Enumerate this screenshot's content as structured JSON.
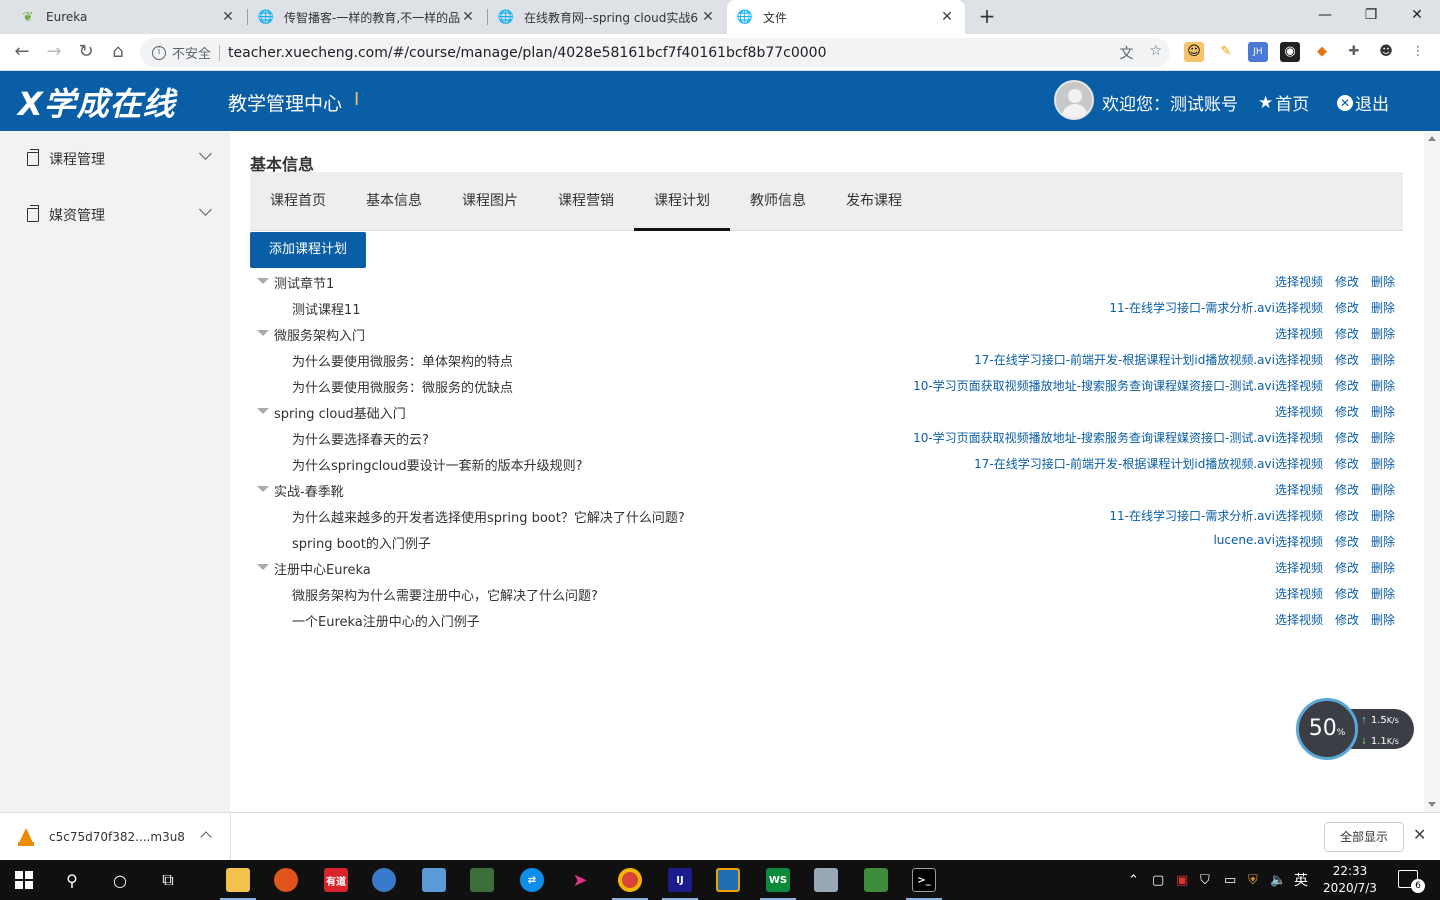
{
  "browser": {
    "tabs": [
      {
        "title": "Eureka",
        "icon": "leaf-icon"
      },
      {
        "title": "传智播客-一样的教育,不一样的品",
        "icon": "globe-icon"
      },
      {
        "title": "在线教育网--spring cloud实战6",
        "icon": "globe-icon"
      },
      {
        "title": "文件",
        "icon": "globe-icon"
      }
    ],
    "insecure_label": "不安全",
    "url": "teacher.xuecheng.com/#/course/manage/plan/4028e58161bcf7f40161bcf8b77c0000"
  },
  "header": {
    "logo": "X学成在线",
    "system_title": "教学管理中心",
    "welcome": "欢迎您：测试账号",
    "home_label": "首页",
    "logout_label": "退出"
  },
  "sidebar": {
    "items": [
      {
        "label": "课程管理"
      },
      {
        "label": "媒资管理"
      }
    ]
  },
  "main": {
    "page_title": "基本信息",
    "tabs": [
      "课程首页",
      "基本信息",
      "课程图片",
      "课程营销",
      "课程计划",
      "教师信息",
      "发布课程"
    ],
    "active_tab": "课程计划",
    "add_button": "添加课程计划",
    "actions": {
      "select_video": "选择视频",
      "edit": "修改",
      "delete": "删除"
    },
    "tree": [
      {
        "level": 1,
        "label": "测试章节1",
        "video": ""
      },
      {
        "level": 2,
        "label": "测试课程11",
        "video": "11-在线学习接口-需求分析.avi"
      },
      {
        "level": 1,
        "label": "微服务架构入门",
        "video": ""
      },
      {
        "level": 2,
        "label": "为什么要使用微服务：单体架构的特点",
        "video": "17-在线学习接口-前端开发-根据课程计划id播放视频.avi"
      },
      {
        "level": 2,
        "label": "为什么要使用微服务：微服务的优缺点",
        "video": "10-学习页面获取视频播放地址-搜索服务查询课程媒资接口-测试.avi"
      },
      {
        "level": 1,
        "label": "spring cloud基础入门",
        "video": ""
      },
      {
        "level": 2,
        "label": "为什么要选择春天的云?",
        "video": "10-学习页面获取视频播放地址-搜索服务查询课程媒资接口-测试.avi"
      },
      {
        "level": 2,
        "label": "为什么springcloud要设计一套新的版本升级规则?",
        "video": "17-在线学习接口-前端开发-根据课程计划id播放视频.avi"
      },
      {
        "level": 1,
        "label": "实战-春季靴",
        "video": ""
      },
      {
        "level": 2,
        "label": "为什么越来越多的开发者选择使用spring boot？它解决了什么问题?",
        "video": "11-在线学习接口-需求分析.avi"
      },
      {
        "level": 2,
        "label": "spring boot的入门例子",
        "video": "lucene.avi"
      },
      {
        "level": 1,
        "label": "注册中心Eureka",
        "video": ""
      },
      {
        "level": 2,
        "label": "微服务架构为什么需要注册中心，它解决了什么问题?",
        "video": ""
      },
      {
        "level": 2,
        "label": "一个Eureka注册中心的入门例子",
        "video": ""
      }
    ]
  },
  "speed_widget": {
    "percent": "50",
    "percent_unit": "%",
    "up": "1.5",
    "up_unit": "K/s",
    "down": "1.1",
    "down_unit": "K/s"
  },
  "download_shelf": {
    "file_name": "c5c75d70f382....m3u8",
    "show_all": "全部显示"
  },
  "taskbar": {
    "ime": "英",
    "time": "22:33",
    "date": "2020/7/3",
    "notifications": "6",
    "youdao_label": "有道"
  }
}
